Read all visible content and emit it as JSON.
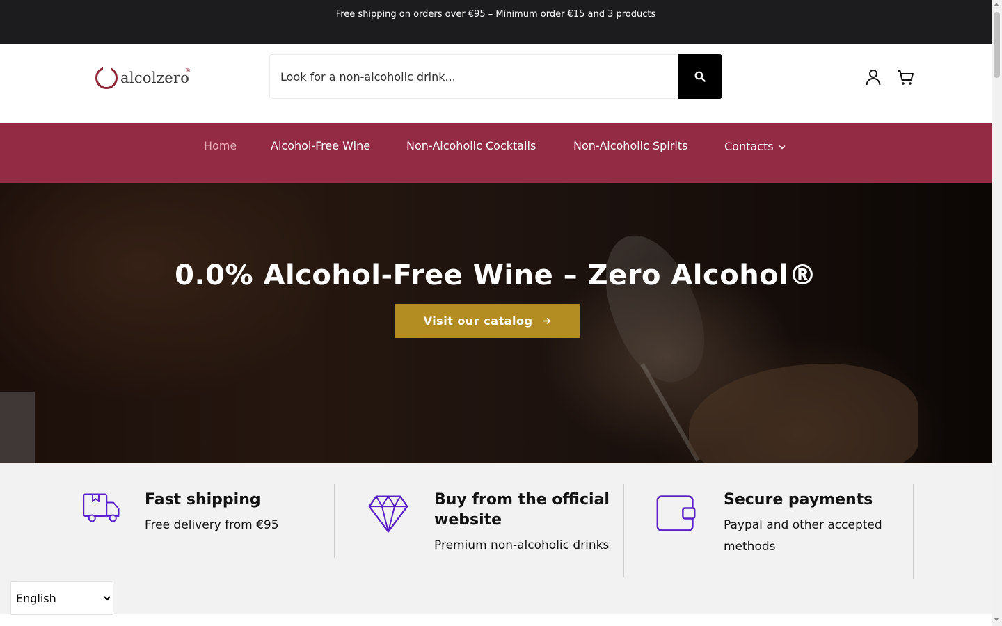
{
  "announcement": {
    "text": "Free shipping on orders over €95 – Minimum order €15 and 3 products"
  },
  "header": {
    "logo_text": "alcolzero",
    "logo_mark": "®",
    "search": {
      "placeholder": "Look for a non-alcoholic drink...",
      "button_icon": "search-icon"
    },
    "icons": [
      "account-icon",
      "cart-icon"
    ]
  },
  "nav": {
    "items": [
      {
        "label": "Home",
        "active": true
      },
      {
        "label": "Alcohol-Free Wine",
        "active": false
      },
      {
        "label": "Non-Alcoholic Cocktails",
        "active": false
      },
      {
        "label": "Non-Alcoholic Spirits",
        "active": false
      },
      {
        "label": "Contacts",
        "active": false,
        "has_dropdown": true
      }
    ],
    "background": "#932b44"
  },
  "hero": {
    "title": "0.0% Alcohol-Free Wine – Zero Alcohol®",
    "cta_label": "Visit our catalog",
    "cta_color": "#b38d21"
  },
  "features": [
    {
      "icon": "truck-icon",
      "title": "Fast shipping",
      "subtitle": "Free delivery from €95"
    },
    {
      "icon": "diamond-icon",
      "title": "Buy from the official website",
      "subtitle": "Premium non-alcoholic drinks"
    },
    {
      "icon": "wallet-icon",
      "title": "Secure payments",
      "subtitle": "Paypal and other accepted methods"
    }
  ],
  "language": {
    "selected": "English"
  },
  "colors": {
    "accent_purple": "#5b21c8",
    "announcement_bg": "#1c1c1e"
  }
}
